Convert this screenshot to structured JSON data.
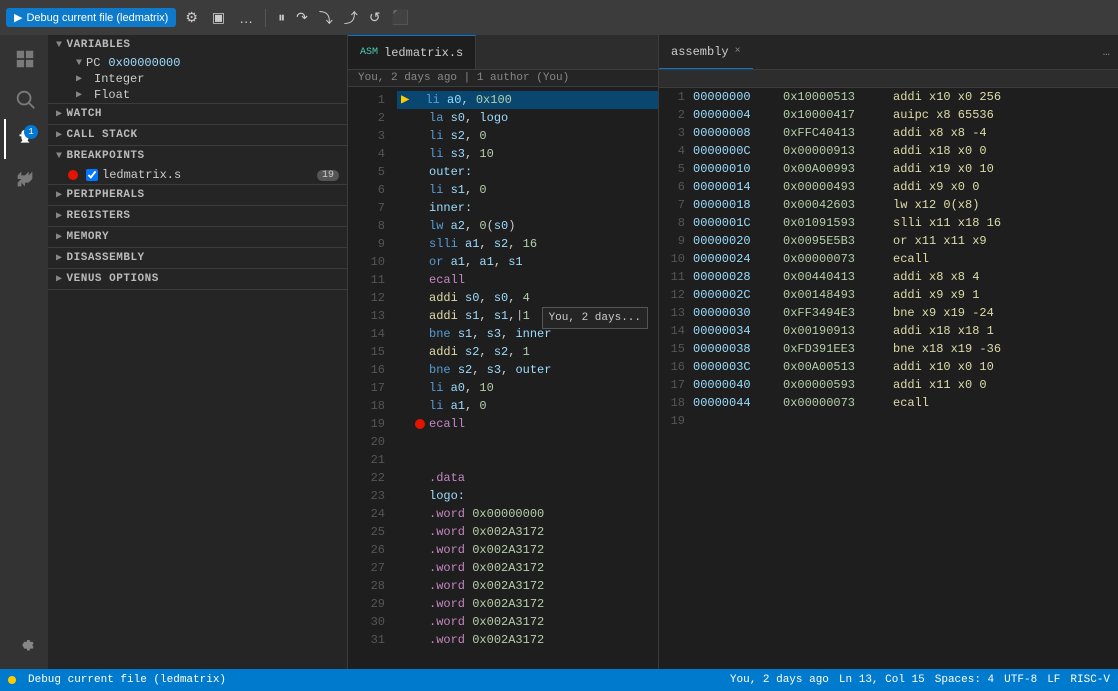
{
  "topbar": {
    "debug_btn": "Debug current file (ledmatrix)",
    "settings_icon": "⚙",
    "screen_icon": "▣",
    "more_icon": "…",
    "run_icon": "▶",
    "step_over_icon": "↷",
    "step_into_icon": "↓",
    "step_out_icon": "↑",
    "restart_icon": "↺",
    "stop_icon": "⬛",
    "debug_icons": [
      "⏸",
      "⏭",
      "↷",
      "↓",
      "↑",
      "↺",
      "⬛"
    ]
  },
  "assembly_tab": {
    "label": "assembly",
    "close": "×",
    "more": "…"
  },
  "sidebar": {
    "variables_header": "VARIABLES",
    "pc_section": {
      "label": "PC",
      "value": "0x00000000"
    },
    "integer_label": "Integer",
    "float_label": "Float",
    "watch_header": "WATCH",
    "call_stack_header": "CALL STACK",
    "breakpoints_header": "BREAKPOINTS",
    "breakpoints": [
      {
        "file": "ledmatrix.s",
        "line": 19
      }
    ],
    "peripherals_header": "PERIPHERALS",
    "registers_header": "REGISTERS",
    "memory_header": "MEMORY",
    "disassembly_header": "DISASSEMBLY",
    "venus_header": "VENUS OPTIONS"
  },
  "editor": {
    "tab_label": "ledmatrix.s",
    "git_info": "You, 2 days ago | 1 author (You)",
    "lines": [
      {
        "num": 1,
        "content": "li a0, 0x100",
        "has_debug_arrow": true,
        "breakpoint": false
      },
      {
        "num": 2,
        "content": "la s0, logo",
        "has_debug_arrow": false,
        "breakpoint": false
      },
      {
        "num": 3,
        "content": "li s2, 0",
        "has_debug_arrow": false,
        "breakpoint": false
      },
      {
        "num": 4,
        "content": "li s3, 10",
        "has_debug_arrow": false,
        "breakpoint": false
      },
      {
        "num": 5,
        "content": "outer:",
        "has_debug_arrow": false,
        "breakpoint": false
      },
      {
        "num": 6,
        "content": "li s1, 0",
        "has_debug_arrow": false,
        "breakpoint": false
      },
      {
        "num": 7,
        "content": "inner:",
        "has_debug_arrow": false,
        "breakpoint": false
      },
      {
        "num": 8,
        "content": "lw a2, 0(s0)",
        "has_debug_arrow": false,
        "breakpoint": false
      },
      {
        "num": 9,
        "content": "slli a1, s2, 16",
        "has_debug_arrow": false,
        "breakpoint": false
      },
      {
        "num": 10,
        "content": "or a1, a1, s1",
        "has_debug_arrow": false,
        "breakpoint": false
      },
      {
        "num": 11,
        "content": "ecall",
        "has_debug_arrow": false,
        "breakpoint": false
      },
      {
        "num": 12,
        "content": "addi s0, s0, 4",
        "has_debug_arrow": false,
        "breakpoint": false
      },
      {
        "num": 13,
        "content": "addi s1, s1, 1",
        "has_debug_arrow": false,
        "breakpoint": false,
        "tooltip": "You, 2 days..."
      },
      {
        "num": 14,
        "content": "bne s1, s3, inner",
        "has_debug_arrow": false,
        "breakpoint": false
      },
      {
        "num": 15,
        "content": "addi s2, s2, 1",
        "has_debug_arrow": false,
        "breakpoint": false
      },
      {
        "num": 16,
        "content": "bne s2, s3, outer",
        "has_debug_arrow": false,
        "breakpoint": false
      },
      {
        "num": 17,
        "content": "li a0, 10",
        "has_debug_arrow": false,
        "breakpoint": false
      },
      {
        "num": 18,
        "content": "li a1, 0",
        "has_debug_arrow": false,
        "breakpoint": false
      },
      {
        "num": 19,
        "content": "ecall",
        "has_debug_arrow": false,
        "breakpoint": true
      },
      {
        "num": 20,
        "content": "",
        "has_debug_arrow": false,
        "breakpoint": false
      },
      {
        "num": 21,
        "content": "",
        "has_debug_arrow": false,
        "breakpoint": false
      },
      {
        "num": 22,
        "content": ".data",
        "has_debug_arrow": false,
        "breakpoint": false
      },
      {
        "num": 23,
        "content": "logo:",
        "has_debug_arrow": false,
        "breakpoint": false
      },
      {
        "num": 24,
        "content": ".word 0x00000000",
        "has_debug_arrow": false,
        "breakpoint": false
      },
      {
        "num": 25,
        "content": ".word 0x002A3172",
        "has_debug_arrow": false,
        "breakpoint": false
      },
      {
        "num": 26,
        "content": ".word 0x002A3172",
        "has_debug_arrow": false,
        "breakpoint": false
      },
      {
        "num": 27,
        "content": ".word 0x002A3172",
        "has_debug_arrow": false,
        "breakpoint": false
      },
      {
        "num": 28,
        "content": ".word 0x002A3172",
        "has_debug_arrow": false,
        "breakpoint": false
      },
      {
        "num": 29,
        "content": ".word 0x002A3172",
        "has_debug_arrow": false,
        "breakpoint": false
      },
      {
        "num": 30,
        "content": ".word 0x002A3172",
        "has_debug_arrow": false,
        "breakpoint": false
      },
      {
        "num": 31,
        "content": ".word 0x002A3172",
        "has_debug_arrow": false,
        "breakpoint": false
      }
    ]
  },
  "assembly": {
    "tab_label": "assembly",
    "rows": [
      {
        "num": 1,
        "addr": "00000000",
        "hex": "0x10000513",
        "instr": "addi x10 x0 256"
      },
      {
        "num": 2,
        "addr": "00000004",
        "hex": "0x10000417",
        "instr": "auipc x8 65536"
      },
      {
        "num": 3,
        "addr": "00000008",
        "hex": "0xFFC40413",
        "instr": "addi x8 x8 -4"
      },
      {
        "num": 4,
        "addr": "0000000C",
        "hex": "0x00000913",
        "instr": "addi x18 x0 0"
      },
      {
        "num": 5,
        "addr": "00000010",
        "hex": "0x00A00993",
        "instr": "addi x19 x0 10"
      },
      {
        "num": 6,
        "addr": "00000014",
        "hex": "0x00000493",
        "instr": "addi x9 x0 0"
      },
      {
        "num": 7,
        "addr": "00000018",
        "hex": "0x00042603",
        "instr": "lw x12 0(x8)"
      },
      {
        "num": 8,
        "addr": "0000001C",
        "hex": "0x01091593",
        "instr": "slli x11 x18 16"
      },
      {
        "num": 9,
        "addr": "00000020",
        "hex": "0x0095E5B3",
        "instr": "or x11 x11 x9"
      },
      {
        "num": 10,
        "addr": "00000024",
        "hex": "0x00000073",
        "instr": "ecall"
      },
      {
        "num": 11,
        "addr": "00000028",
        "hex": "0x00440413",
        "instr": "addi x8 x8 4"
      },
      {
        "num": 12,
        "addr": "0000002C",
        "hex": "0x00148493",
        "instr": "addi x9 x9 1"
      },
      {
        "num": 13,
        "addr": "00000030",
        "hex": "0xFF3494E3",
        "instr": "bne x9 x19 -24"
      },
      {
        "num": 14,
        "addr": "00000034",
        "hex": "0x00190913",
        "instr": "addi x18 x18 1"
      },
      {
        "num": 15,
        "addr": "00000038",
        "hex": "0xFD391EE3",
        "instr": "bne x18 x19 -36"
      },
      {
        "num": 16,
        "addr": "0000003C",
        "hex": "0x00A00513",
        "instr": "addi x10 x0 10"
      },
      {
        "num": 17,
        "addr": "00000040",
        "hex": "0x00000593",
        "instr": "addi x11 x0 0"
      },
      {
        "num": 18,
        "addr": "00000044",
        "hex": "0x00000073",
        "instr": "ecall"
      },
      {
        "num": 19,
        "addr": "",
        "hex": "",
        "instr": ""
      }
    ]
  },
  "statusbar": {
    "debug_label": "Debug current file (ledmatrix)",
    "git_info": "You, 2 days ago",
    "position": "Ln 13, Col 15",
    "spaces": "Spaces: 4",
    "encoding": "UTF-8",
    "line_ending": "LF",
    "language": "RISC-V"
  }
}
